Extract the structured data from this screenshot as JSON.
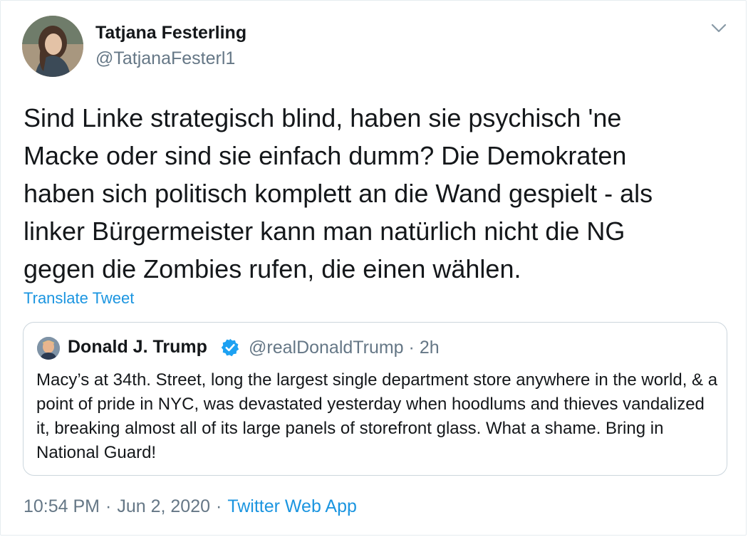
{
  "author": {
    "display_name": "Tatjana Festerling",
    "handle": "@TatjanaFesterl1",
    "avatar_icon": "profile-photo"
  },
  "menu_icon": "chevron-down-icon",
  "tweet": {
    "text": "Sind Linke strategisch blind, haben sie psychisch 'ne\nMacke oder sind sie einfach dumm? Die Demokraten\nhaben sich politisch komplett an die Wand gespielt - als\nlinker Bürgermeister kann man natürlich nicht die NG\ngegen die Zombies rufen, die einen wählen.",
    "translate_label": "Translate Tweet"
  },
  "quoted": {
    "display_name": "Donald J. Trump",
    "verified_icon": "verified-badge-icon",
    "handle": "@realDonaldTrump",
    "separator": "·",
    "time": "2h",
    "text": "Macy’s at 34th. Street, long the largest single department store anywhere in the world, & a point of pride in NYC, was devastated yesterday when hoodlums and thieves vandalized it, breaking almost all of its large panels of storefront glass. What a shame. Bring in National Guard!"
  },
  "footer": {
    "time": "10:54 PM",
    "separator": "·",
    "date": "Jun 2, 2020",
    "source": "Twitter Web App"
  },
  "colors": {
    "link": "#1b95e0",
    "secondary_text": "#657786",
    "verified": "#1da1f2"
  }
}
